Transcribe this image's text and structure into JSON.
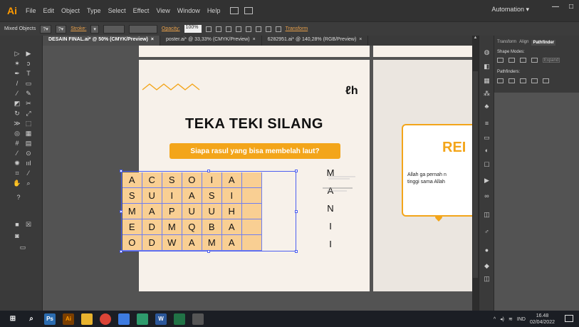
{
  "menu": {
    "app_logo": "Ai",
    "items": [
      "File",
      "Edit",
      "Object",
      "Type",
      "Select",
      "Effect",
      "View",
      "Window",
      "Help"
    ],
    "workspace": "Automation",
    "workspace_arrow": "▾"
  },
  "control_bar": {
    "selection": "Mixed Objects",
    "stroke_label": "Stroke:",
    "opacity_label": "Opacity:",
    "opacity_value": "100%",
    "transform_label": "Transform"
  },
  "tabs": [
    {
      "label": "DESAIN FINAL.ai* @ 50% (CMYK/Preview)",
      "close": "×"
    },
    {
      "label": "poster.ai* @ 33,33% (CMYK/Preview)",
      "close": "×"
    },
    {
      "label": "6282951.ai* @ 140,28% (RGB/Preview)",
      "close": "×"
    }
  ],
  "artboard": {
    "logo": "ℓh",
    "title": "TEKA TEKI SILANG",
    "question": "Siapa rasul yang bisa membelah laut?",
    "grid": [
      [
        "A",
        "C",
        "S",
        "O",
        "I",
        "A",
        ""
      ],
      [
        "S",
        "U",
        "I",
        "A",
        "S",
        "I",
        ""
      ],
      [
        "M",
        "A",
        "P",
        "U",
        "U",
        "H",
        ""
      ],
      [
        "E",
        "D",
        "M",
        "Q",
        "B",
        "A",
        ""
      ],
      [
        "O",
        "D",
        "W",
        "A",
        "M",
        "A",
        ""
      ]
    ],
    "answer_letters": [
      "M",
      "A",
      "N",
      "I",
      "I"
    ]
  },
  "artboard2": {
    "heading": "REI",
    "line1": "Allah ga pernah n",
    "line2": "tinggi sama Allah"
  },
  "panel": {
    "tabs": [
      "Transform",
      "Align",
      "Pathfinder"
    ],
    "shape_modes": "Shape Modes:",
    "pathfinders": "Pathfinders:",
    "expand": "Expand"
  },
  "taskbar": {
    "apps": [
      {
        "name": "photoshop",
        "label": "Ps",
        "color": "#2b6cb0"
      },
      {
        "name": "illustrator",
        "label": "Ai",
        "color": "#7a3e00"
      },
      {
        "name": "file-explorer",
        "label": "",
        "color": "#e8b32e"
      },
      {
        "name": "chrome",
        "label": "",
        "color": "#db4437"
      },
      {
        "name": "app-5",
        "label": "",
        "color": "#3d7be0"
      },
      {
        "name": "app-6",
        "label": "",
        "color": "#2e9b6d"
      },
      {
        "name": "word",
        "label": "W",
        "color": "#2b579a"
      },
      {
        "name": "excel",
        "label": "",
        "color": "#217346"
      },
      {
        "name": "app-9",
        "label": "",
        "color": "#555"
      }
    ],
    "lang": "IND",
    "time": "16.48",
    "date": "02/04/2022"
  }
}
